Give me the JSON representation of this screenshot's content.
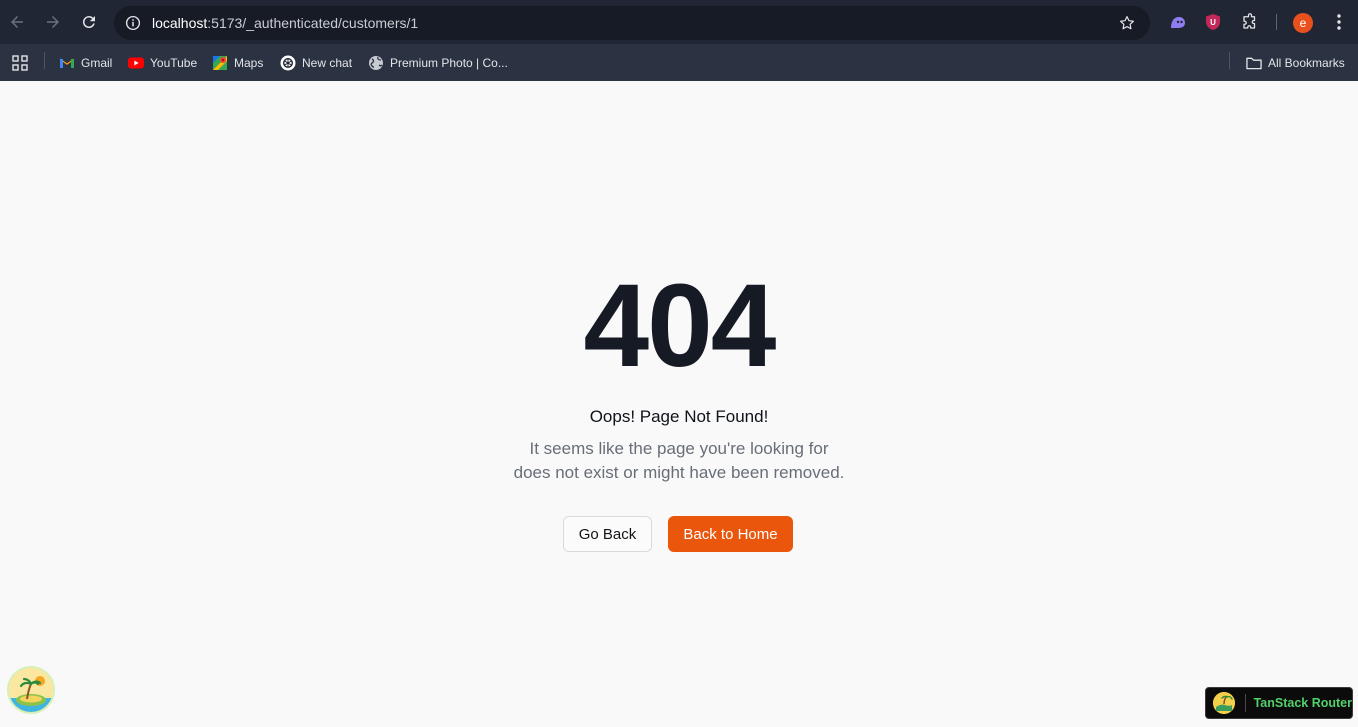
{
  "browser": {
    "url_host": "localhost",
    "url_path": ":5173/_authenticated/customers/1",
    "profile_initial": "e",
    "accent": "#e8501e"
  },
  "bookmarks": {
    "items": [
      {
        "label": "Gmail",
        "icon": "gmail-icon"
      },
      {
        "label": "YouTube",
        "icon": "youtube-icon"
      },
      {
        "label": "Maps",
        "icon": "maps-icon"
      },
      {
        "label": "New chat",
        "icon": "openai-icon"
      },
      {
        "label": "Premium Photo | Co...",
        "icon": "globe-icon"
      }
    ],
    "all_bookmarks": "All Bookmarks"
  },
  "page": {
    "code": "404",
    "heading": "Oops! Page Not Found!",
    "description_line1": "It seems like the page you're looking for",
    "description_line2": "does not exist or might have been removed.",
    "go_back": "Go Back",
    "back_home": "Back to Home",
    "primary_color": "#ea560c"
  },
  "devtools": {
    "label": "TanStack Router"
  }
}
